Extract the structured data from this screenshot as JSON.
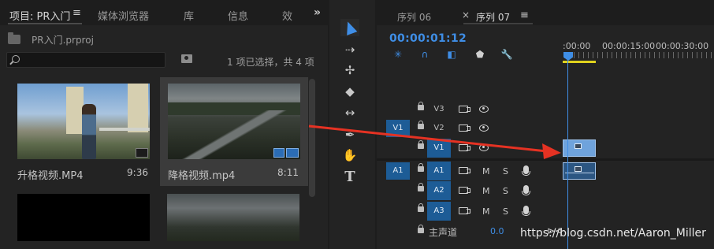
{
  "project_panel": {
    "tabs": [
      "项目: PR入门",
      "媒体浏览器",
      "库",
      "信息",
      "效"
    ],
    "active_tab_menu": "≡",
    "more": "»",
    "project_file": "PR入门.prproj",
    "search_placeholder": "",
    "selection_status": "1 项已选择，共 4 项",
    "clips": [
      {
        "name": "升格视频.MP4",
        "duration": "9:36"
      },
      {
        "name": "降格视频.mp4",
        "duration": "8:11"
      }
    ]
  },
  "tools": {
    "icons": [
      "selection-tool",
      "track-select-tool",
      "ripple-edit-tool",
      "razor-tool",
      "slip-tool",
      "pen-tool",
      "hand-tool",
      "type-tool"
    ],
    "type_glyph": "T"
  },
  "timeline": {
    "tabs": [
      {
        "label": "序列 06"
      },
      {
        "label": "序列 07",
        "close": "×",
        "menu": "≡"
      }
    ],
    "timecode": "00:00:01:12",
    "ruler_labels": [
      ":00:00",
      "00:00:15:00",
      "00:00:30:00"
    ],
    "tracks": [
      {
        "src": "",
        "label": "V3",
        "kind": "video"
      },
      {
        "src": "V1",
        "label": "V2",
        "kind": "video"
      },
      {
        "src": "",
        "label": "V1",
        "kind": "video"
      },
      {
        "src": "A1",
        "label": "A1",
        "kind": "audio",
        "m": "M",
        "s": "S"
      },
      {
        "src": "",
        "label": "A2",
        "kind": "audio",
        "m": "M",
        "s": "S"
      },
      {
        "src": "",
        "label": "A3",
        "kind": "audio",
        "m": "M",
        "s": "S"
      }
    ],
    "master_label": "主声道",
    "master_value": "0.0",
    "end_icon": "⊳⊲"
  },
  "watermark": "https://blog.csdn.net/Aaron_Miller",
  "colors": {
    "accent": "#3f8ee6",
    "track_target": "#1d5c96",
    "work_area": "#e0d21d",
    "annotation_arrow": "#e53223"
  }
}
